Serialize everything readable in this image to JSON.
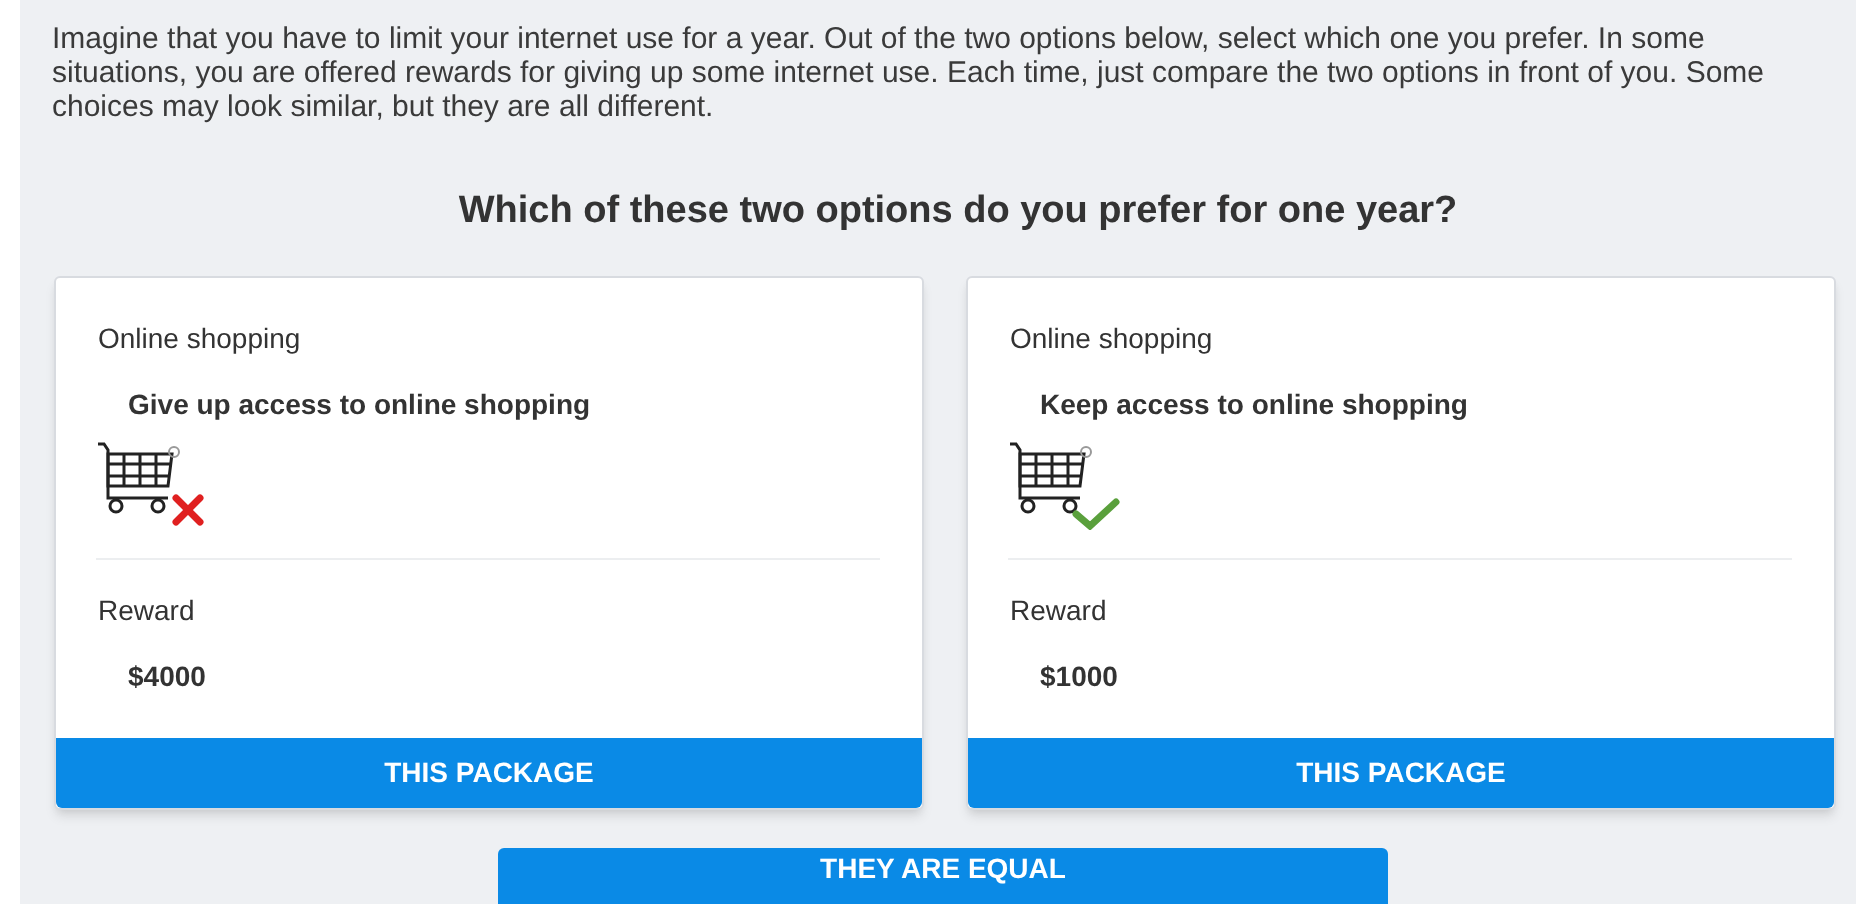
{
  "instructions": "Imagine that you have to limit your internet use for a year. Out of the two options below, select which one you prefer. In some situations, you are offered rewards for giving up some internet use. Each time, just compare the two options in front of you. Some choices may look similar, but they are all different.",
  "question": "Which of these two options do you prefer for one year?",
  "options": [
    {
      "category": "Online shopping",
      "description": "Give up access to online shopping",
      "kind": "cross",
      "reward_label": "Reward",
      "reward": "$4000",
      "button": "THIS PACKAGE"
    },
    {
      "category": "Online shopping",
      "description": "Keep access to online shopping",
      "kind": "check",
      "reward_label": "Reward",
      "reward": "$1000",
      "button": "THIS PACKAGE"
    }
  ],
  "equal_button": "THEY ARE EQUAL"
}
